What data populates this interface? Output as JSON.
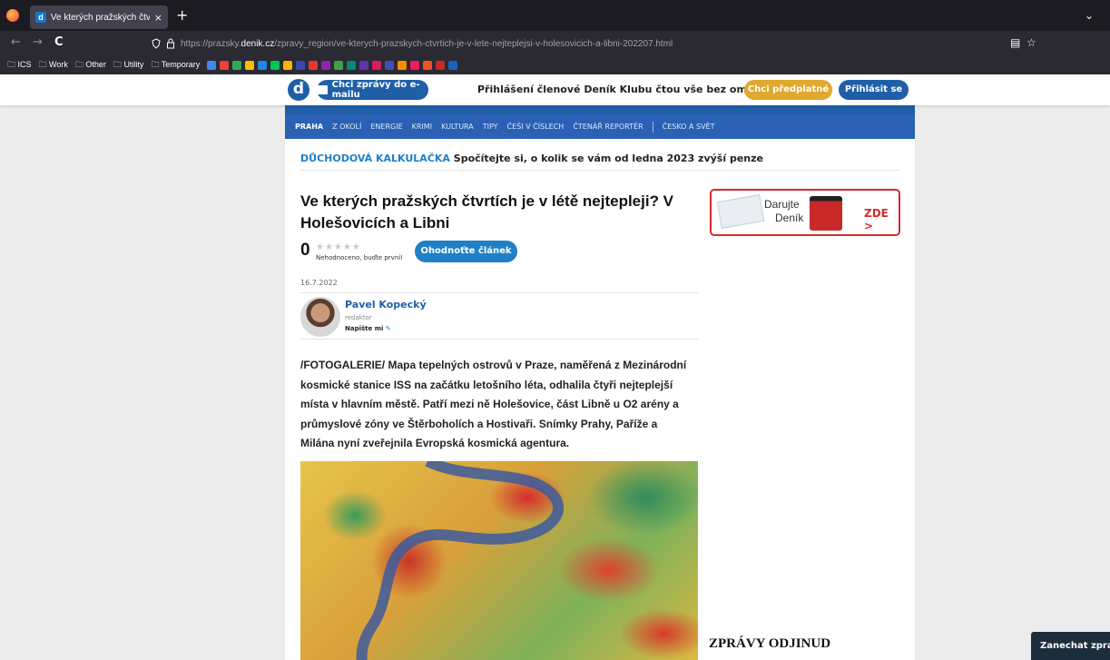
{
  "browser": {
    "tab_title": "Ve kterých pražských čtvrtích je",
    "tab_close": "×",
    "new_tab": "+",
    "tab_list": "⌄",
    "url_prefix": "https://prazsky.",
    "url_domain": "denik.cz",
    "url_rest": "/zpravy_region/ve-kterych-prazskych-ctvrtich-je-v-lete-nejteplejsi-v-holesovicich-a-libni-202207.html",
    "back": "←",
    "forward": "→",
    "reload": "C",
    "reader_icon": "▤",
    "star_icon": "☆"
  },
  "bookmarks": [
    {
      "label": "ICS"
    },
    {
      "label": "Work"
    },
    {
      "label": "Other"
    },
    {
      "label": "Utility"
    },
    {
      "label": "Temporary"
    }
  ],
  "bookmark_icon_colors": [
    "#4285f4",
    "#ea4335",
    "#34a853",
    "#fbbc05",
    "#1e88e5",
    "#00c853",
    "#ffb300",
    "#3949ab",
    "#e53935",
    "#8e24aa",
    "#43a047",
    "#00897b",
    "#5e35b1",
    "#d81b60",
    "#3f51b5",
    "#fb8c00",
    "#e91e63",
    "#f4511e",
    "#c62828",
    "#1565c0"
  ],
  "topbar": {
    "logo": "d",
    "email_button": "Chci zprávy do e-mailu",
    "club_text": "Přihlášení členové Deník Klubu čtou vše bez omezení.",
    "subscribe_button": "Chci předplatné",
    "login_button": "Přihlásit se"
  },
  "subnav": {
    "items": [
      "PRAHA",
      "Z OKOLÍ",
      "ENERGIE",
      "KRIMI",
      "KULTURA",
      "TIPY",
      "ČEŠI V ČÍSLECH",
      "ČTENÁŘ REPORTÉR",
      "ČESKO A SVĚT"
    ]
  },
  "calc": {
    "keyword": "DŮCHODOVÁ KALKULAČKA",
    "text": "Spočítejte si, o kolik se vám od ledna 2023 zvýší penze"
  },
  "article": {
    "title": "Ve kterých pražských čtvrtích je v létě nejtepleji? V Holešovicích a Libni",
    "rating": "0",
    "stars": "★★★★★",
    "rating_note": "Nehodnoceno, buďte první!",
    "rate_button": "Ohodnoťte článek",
    "date": "16.7.2022",
    "author": "Pavel Kopecký",
    "author_role": "redaktor",
    "write_me": "Napište mi",
    "write_icon": "✎",
    "lead": "/FOTOGALERIE/ Mapa tepelných ostrovů v Praze, naměřená z Mezinárodní kosmické stanice ISS na začátku letošního léta, odhalila čtyři nejteplejší místa v hlavním městě. Patří mezi ně Holešovice, část Libně u O2 arény a průmyslové zóny ve Štěrboholích a Hostivaři. Snímky Prahy, Paříže a Milána nyní zveřejnila Evropská kosmická agentura."
  },
  "promo": {
    "line1": "Darujte",
    "line2": "Deník",
    "cta": "ZDE >"
  },
  "sidebar": {
    "other_news": "ZPRÁVY ODJINUD"
  },
  "feedback": "Zanechat zpráv"
}
